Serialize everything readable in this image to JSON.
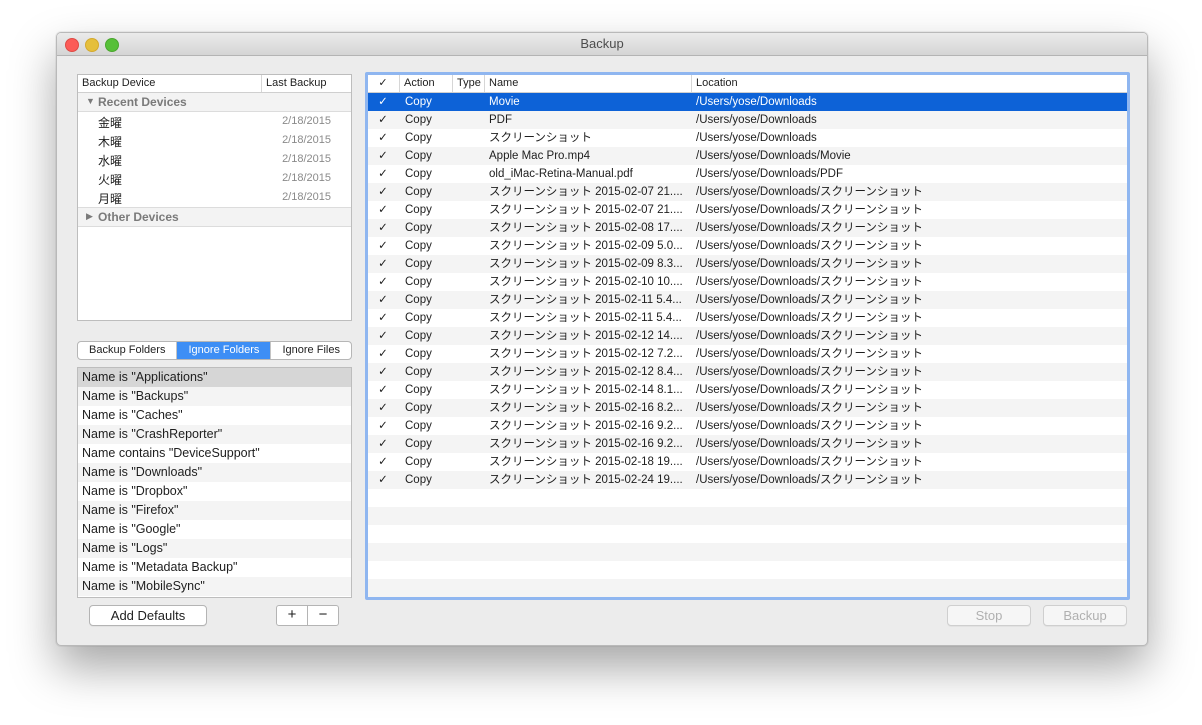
{
  "window": {
    "title": "Backup"
  },
  "devices": {
    "col_device": "Backup Device",
    "col_last": "Last Backup",
    "recent_label": "Recent Devices",
    "other_label": "Other Devices",
    "recent": [
      {
        "name": "金曜",
        "date": "2/18/2015"
      },
      {
        "name": "木曜",
        "date": "2/18/2015"
      },
      {
        "name": "水曜",
        "date": "2/18/2015"
      },
      {
        "name": "火曜",
        "date": "2/18/2015"
      },
      {
        "name": "月曜",
        "date": "2/18/2015"
      }
    ]
  },
  "tabs": [
    "Backup Folders",
    "Ignore Folders",
    "Ignore Files"
  ],
  "active_tab": 1,
  "rules": [
    "Name is \"Applications\"",
    "Name is \"Backups\"",
    "Name is \"Caches\"",
    "Name is \"CrashReporter\"",
    "Name contains \"DeviceSupport\"",
    "Name is \"Downloads\"",
    "Name is \"Dropbox\"",
    "Name is \"Firefox\"",
    "Name is \"Google\"",
    "Name is \"Logs\"",
    "Name is \"Metadata Backup\"",
    "Name is \"MobileSync\""
  ],
  "buttons": {
    "add_defaults": "Add Defaults",
    "plus": "+",
    "minus": "−",
    "stop": "Stop",
    "backup": "Backup"
  },
  "files": {
    "headers": {
      "check": "✓",
      "action": "Action",
      "type": "Type",
      "name": "Name",
      "location": "Location"
    },
    "rows": [
      {
        "check": "✓",
        "action": "Copy",
        "folder": true,
        "name": "Movie",
        "location": "/Users/yose/Downloads"
      },
      {
        "check": "✓",
        "action": "Copy",
        "folder": true,
        "name": "PDF",
        "location": "/Users/yose/Downloads"
      },
      {
        "check": "✓",
        "action": "Copy",
        "folder": true,
        "name": "スクリーンショット",
        "location": "/Users/yose/Downloads"
      },
      {
        "check": "✓",
        "action": "Copy",
        "folder": false,
        "name": "Apple Mac Pro.mp4",
        "location": "/Users/yose/Downloads/Movie"
      },
      {
        "check": "✓",
        "action": "Copy",
        "folder": false,
        "name": "old_iMac-Retina-Manual.pdf",
        "location": "/Users/yose/Downloads/PDF"
      },
      {
        "check": "✓",
        "action": "Copy",
        "folder": false,
        "name": "スクリーンショット 2015-02-07 21....",
        "location": "/Users/yose/Downloads/スクリーンショット"
      },
      {
        "check": "✓",
        "action": "Copy",
        "folder": false,
        "name": "スクリーンショット 2015-02-07 21....",
        "location": "/Users/yose/Downloads/スクリーンショット"
      },
      {
        "check": "✓",
        "action": "Copy",
        "folder": false,
        "name": "スクリーンショット 2015-02-08 17....",
        "location": "/Users/yose/Downloads/スクリーンショット"
      },
      {
        "check": "✓",
        "action": "Copy",
        "folder": false,
        "name": "スクリーンショット 2015-02-09 5.0...",
        "location": "/Users/yose/Downloads/スクリーンショット"
      },
      {
        "check": "✓",
        "action": "Copy",
        "folder": false,
        "name": "スクリーンショット 2015-02-09 8.3...",
        "location": "/Users/yose/Downloads/スクリーンショット"
      },
      {
        "check": "✓",
        "action": "Copy",
        "folder": false,
        "name": "スクリーンショット 2015-02-10 10....",
        "location": "/Users/yose/Downloads/スクリーンショット"
      },
      {
        "check": "✓",
        "action": "Copy",
        "folder": false,
        "name": "スクリーンショット 2015-02-11 5.4...",
        "location": "/Users/yose/Downloads/スクリーンショット"
      },
      {
        "check": "✓",
        "action": "Copy",
        "folder": false,
        "name": "スクリーンショット 2015-02-11 5.4...",
        "location": "/Users/yose/Downloads/スクリーンショット"
      },
      {
        "check": "✓",
        "action": "Copy",
        "folder": false,
        "name": "スクリーンショット 2015-02-12 14....",
        "location": "/Users/yose/Downloads/スクリーンショット"
      },
      {
        "check": "✓",
        "action": "Copy",
        "folder": false,
        "name": "スクリーンショット 2015-02-12 7.2...",
        "location": "/Users/yose/Downloads/スクリーンショット"
      },
      {
        "check": "✓",
        "action": "Copy",
        "folder": false,
        "name": "スクリーンショット 2015-02-12 8.4...",
        "location": "/Users/yose/Downloads/スクリーンショット"
      },
      {
        "check": "✓",
        "action": "Copy",
        "folder": false,
        "name": "スクリーンショット 2015-02-14 8.1...",
        "location": "/Users/yose/Downloads/スクリーンショット"
      },
      {
        "check": "✓",
        "action": "Copy",
        "folder": false,
        "name": "スクリーンショット 2015-02-16 8.2...",
        "location": "/Users/yose/Downloads/スクリーンショット"
      },
      {
        "check": "✓",
        "action": "Copy",
        "folder": false,
        "name": "スクリーンショット 2015-02-16 9.2...",
        "location": "/Users/yose/Downloads/スクリーンショット"
      },
      {
        "check": "✓",
        "action": "Copy",
        "folder": false,
        "name": "スクリーンショット 2015-02-16 9.2...",
        "location": "/Users/yose/Downloads/スクリーンショット"
      },
      {
        "check": "✓",
        "action": "Copy",
        "folder": false,
        "name": "スクリーンショット 2015-02-18 19....",
        "location": "/Users/yose/Downloads/スクリーンショット"
      },
      {
        "check": "✓",
        "action": "Copy",
        "folder": false,
        "name": "スクリーンショット 2015-02-24 19....",
        "location": "/Users/yose/Downloads/スクリーンショット"
      }
    ]
  },
  "colors": {
    "selection": "#0d62d7",
    "focus_ring": "#8fb6f0",
    "segment_active": "#3d8ef5",
    "folder": "#3a9be6"
  }
}
